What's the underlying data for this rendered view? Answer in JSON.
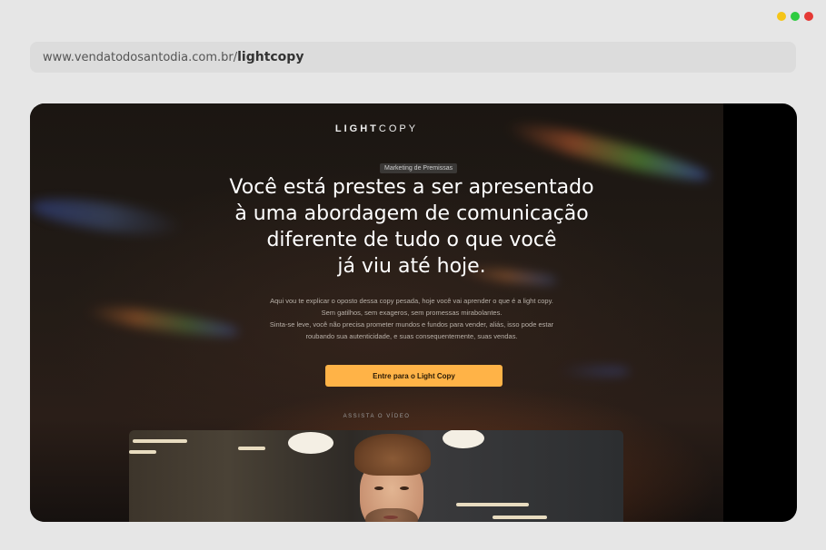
{
  "window": {
    "dots": [
      "#f5c518",
      "#2ecc40",
      "#e53935"
    ]
  },
  "address_bar": {
    "domain": "www.vendatodosantodia.com.br/",
    "path": "lightcopy"
  },
  "site": {
    "logo_light": "LIGHT",
    "logo_copy": "COPY",
    "tag": "Marketing de Premissas",
    "headline": [
      "Você está prestes a ser apresentado",
      "à uma abordagem de comunicação",
      "diferente de tudo o que você",
      "já viu até hoje."
    ],
    "sub": [
      "Aqui vou te explicar o oposto dessa copy pesada, hoje você vai aprender o que é a light copy.",
      "Sem gatilhos, sem exageros, sem promessas mirabolantes.",
      "Sinta-se leve, você não precisa prometer mundos e fundos para vender, aliás, isso pode estar",
      "roubando sua autenticidade, e suas consequentemente, suas vendas."
    ],
    "cta_label": "Entre para o Light Copy",
    "watch_label": "ASSISTA O VÍDEO",
    "accent": "#ffb347"
  }
}
